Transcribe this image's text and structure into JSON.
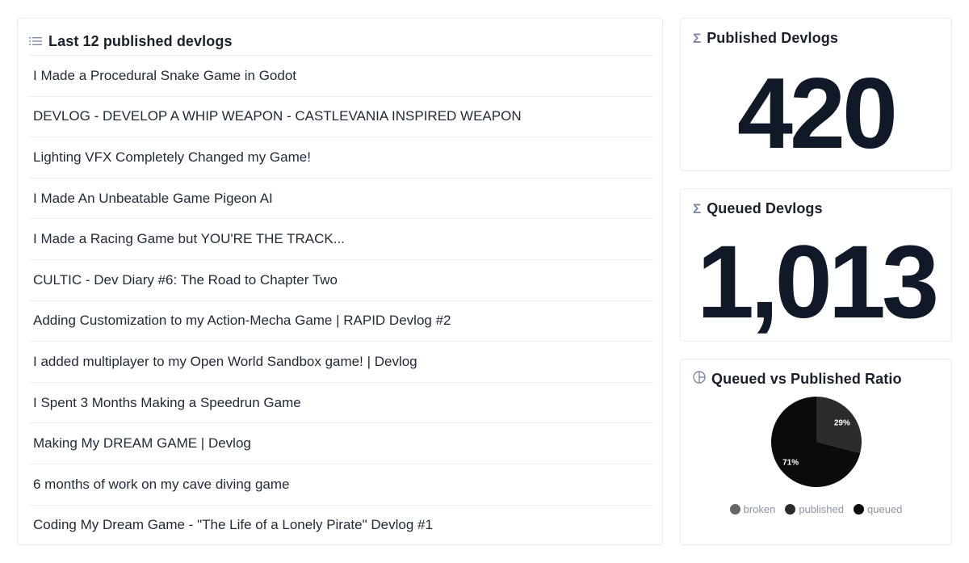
{
  "list": {
    "title": "Last 12 published devlogs",
    "icon": "list-icon",
    "items": [
      "I Made a Procedural Snake Game in Godot",
      "DEVLOG - DEVELOP A WHIP WEAPON - CASTLEVANIA INSPIRED WEAPON",
      "Lighting VFX Completely Changed my Game!",
      "I Made An Unbeatable Game Pigeon AI",
      "I Made a Racing Game but YOU'RE THE TRACK...",
      "CULTIC - Dev Diary #6: The Road to Chapter Two",
      "Adding Customization to my Action-Mecha Game | RAPID Devlog #2",
      "I added multiplayer to my Open World Sandbox game! | Devlog",
      "I Spent 3 Months Making a Speedrun Game",
      "Making My DREAM GAME | Devlog",
      "6 months of work on my cave diving game",
      "Coding My Dream Game - \"The Life of a Lonely Pirate\" Devlog #1"
    ]
  },
  "published": {
    "title": "Published Devlogs",
    "icon": "sigma-icon",
    "value": "420"
  },
  "queued": {
    "title": "Queued Devlogs",
    "icon": "sigma-icon",
    "value": "1,013"
  },
  "ratio": {
    "title": "Queued vs Published Ratio",
    "icon": "pie-chart-icon"
  },
  "chart_data": {
    "type": "pie",
    "title": "Queued vs Published Ratio",
    "slices": [
      {
        "name": "broken",
        "value": 0,
        "label": "",
        "color": "#666666"
      },
      {
        "name": "published",
        "value": 29,
        "label": "29%",
        "color": "#2b2b2b"
      },
      {
        "name": "queued",
        "value": 71,
        "label": "71%",
        "color": "#0b0b0b"
      }
    ],
    "legend": "bottom"
  },
  "colors": {
    "text_primary": "#1a202c",
    "icon_muted": "#7c8aa5",
    "border": "#e9ecef"
  }
}
